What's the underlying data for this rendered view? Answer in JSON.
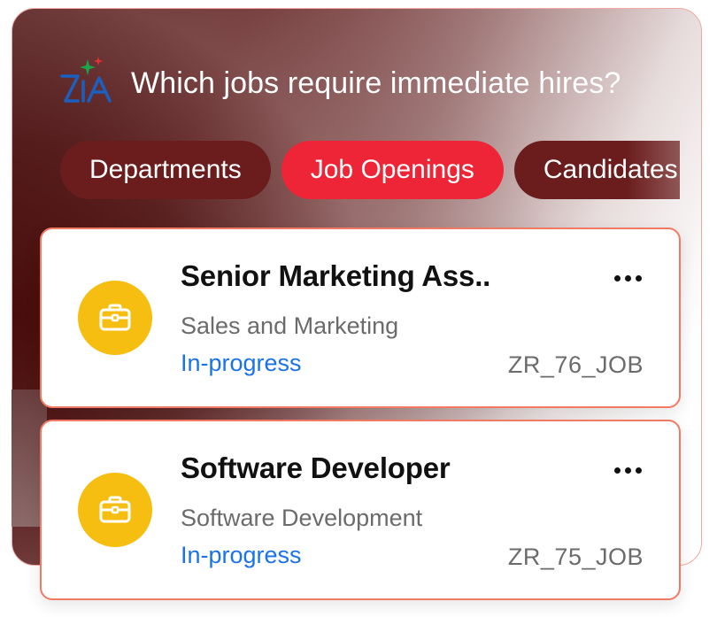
{
  "header": {
    "logo_icon": "zia-logo-icon",
    "question": "Which jobs require immediate hires?"
  },
  "tabs": [
    {
      "label": "Departments",
      "active": false
    },
    {
      "label": "Job Openings",
      "active": true
    },
    {
      "label": "Candidates",
      "active": false
    }
  ],
  "cards": [
    {
      "title": "Senior Marketing Ass..",
      "department": "Sales and Marketing",
      "status": "In-progress",
      "job_id": "ZR_76_JOB",
      "icon": "briefcase-icon"
    },
    {
      "title": "Software Developer",
      "department": "Software Development",
      "status": "In-progress",
      "job_id": "ZR_75_JOB",
      "icon": "briefcase-icon"
    }
  ],
  "colors": {
    "accent": "#ee2536",
    "tab_inactive": "#6b1d1d",
    "status_blue": "#1a73e8",
    "icon_yellow": "#f6be10",
    "card_border": "#f27a63"
  }
}
